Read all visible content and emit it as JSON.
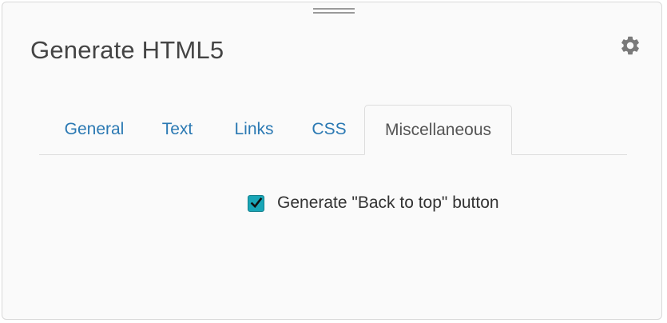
{
  "dialog": {
    "title": "Generate HTML5",
    "settings_icon": "gear-icon",
    "drag_handle_icon": "drag-handle-icon"
  },
  "tabs": [
    {
      "label": "General",
      "active": false
    },
    {
      "label": "Text",
      "active": false
    },
    {
      "label": "Links",
      "active": false
    },
    {
      "label": "CSS",
      "active": false
    },
    {
      "label": "Miscellaneous",
      "active": true
    }
  ],
  "miscellaneous": {
    "back_to_top": {
      "label": "Generate \"Back to top\" button",
      "checked": true
    }
  },
  "colors": {
    "tab_link": "#2b79b3",
    "tab_active_text": "#555555",
    "checkbox_fill": "#19a6b7",
    "panel_background": "#fafafa"
  }
}
